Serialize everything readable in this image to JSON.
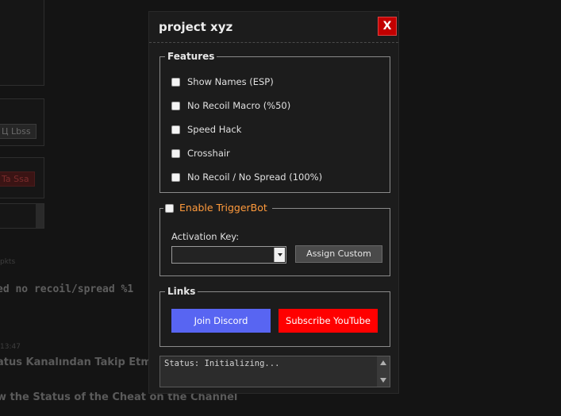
{
  "background": {
    "button_1": "Ц Lbss",
    "button_2": "Ta Ssa",
    "code_line": "ed no recoil/spread %1",
    "line_1": "atus Kanalından Takip Etme",
    "line_2": "w the Status of the Cheat on the Channel",
    "tiny_1": "pkts",
    "tiny_2": "13:47"
  },
  "window": {
    "title": "project xyz",
    "close_label": "X"
  },
  "features": {
    "legend": "Features",
    "items": [
      {
        "label": "Show Names (ESP)",
        "checked": false
      },
      {
        "label": "No Recoil Macro (%50)",
        "checked": false
      },
      {
        "label": "Speed Hack",
        "checked": false
      },
      {
        "label": "Crosshair",
        "checked": false
      },
      {
        "label": "No Recoil / No Spread (100%)",
        "checked": false
      }
    ]
  },
  "triggerbot": {
    "legend": "Enable TriggerBot",
    "enabled": false,
    "activation_label": "Activation Key:",
    "selected_key": "",
    "assign_label": "Assign Custom",
    "accent_color": "#ff9a3c"
  },
  "links": {
    "legend": "Links",
    "discord_label": "Join Discord",
    "discord_color": "#5865f2",
    "youtube_label": "Subscribe YouTube",
    "youtube_color": "#ff0000"
  },
  "status": {
    "text": "Status: Initializing..."
  }
}
